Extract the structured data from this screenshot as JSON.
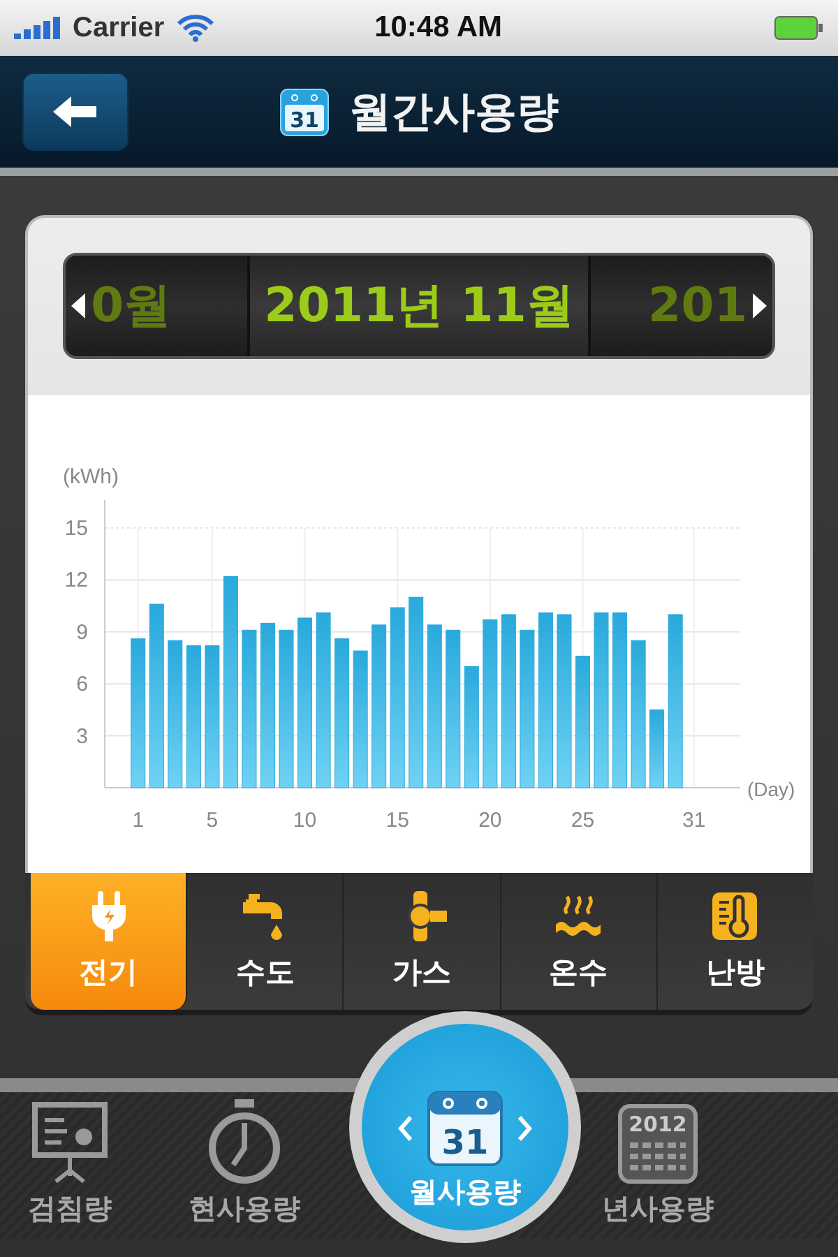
{
  "status_bar": {
    "carrier": "Carrier",
    "time": "10:48 AM"
  },
  "nav_bar": {
    "title": "월간사용량",
    "icon_text": "31"
  },
  "month_picker": {
    "previous": "0월",
    "current": "2011년 11월",
    "next": "201"
  },
  "chart": {
    "chart_data": {
      "type": "bar",
      "xlabel": "(Day)",
      "ylabel": "(kWh)",
      "x": [
        1,
        2,
        3,
        4,
        5,
        6,
        7,
        8,
        9,
        10,
        11,
        12,
        13,
        14,
        15,
        16,
        17,
        18,
        19,
        20,
        21,
        22,
        23,
        24,
        25,
        26,
        27,
        28,
        29,
        30
      ],
      "grid": true,
      "series": [
        {
          "color": "#29a9dc",
          "values": [
            8.6,
            10.6,
            8.5,
            8.2,
            8.2,
            12.2,
            9.1,
            9.5,
            9.1,
            9.8,
            10.1,
            8.6,
            7.9,
            9.4,
            10.4,
            11.0,
            9.4,
            9.1,
            7.0,
            9.7,
            10.0,
            9.1,
            10.1,
            10.0,
            7.6,
            10.1,
            10.1,
            8.5,
            4.5,
            10.0
          ]
        }
      ],
      "xlim": [
        -0.8,
        33.5
      ],
      "ylim": [
        0,
        15
      ],
      "xticks": [
        1,
        5,
        10,
        15,
        20,
        25,
        31
      ],
      "yticks": [
        3,
        6,
        9,
        12,
        15
      ]
    }
  },
  "utility_tabs": [
    {
      "label": "전기",
      "kind": "plug",
      "selected": true
    },
    {
      "label": "수도",
      "kind": "faucet",
      "selected": false
    },
    {
      "label": "가스",
      "kind": "valve",
      "selected": false
    },
    {
      "label": "온수",
      "kind": "steam",
      "selected": false
    },
    {
      "label": "난방",
      "kind": "thermometer",
      "selected": false
    }
  ],
  "bottom_tabs": [
    {
      "label": "검침량",
      "kind": "board",
      "selected": false
    },
    {
      "label": "현사용량",
      "kind": "stopwatch",
      "selected": false
    },
    {
      "label": "월사용량",
      "kind": "calendar",
      "icon_text": "31",
      "selected": true
    },
    {
      "label": "년사용량",
      "kind": "year",
      "icon_text": "2012",
      "selected": false
    }
  ]
}
